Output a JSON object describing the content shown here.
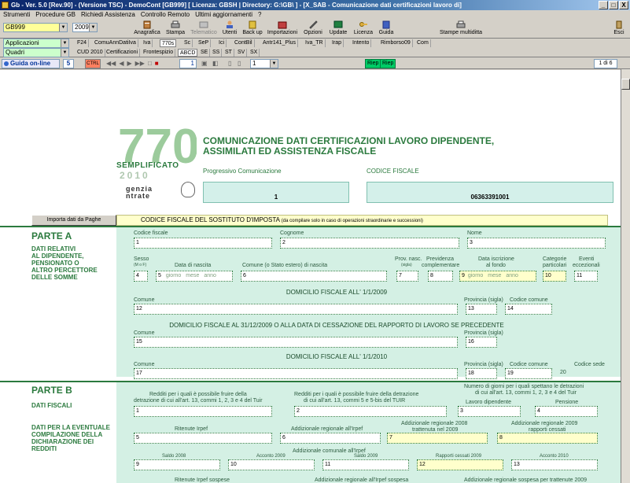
{
  "window": {
    "title": "Gb - Ver. 5.0 [Rev.90] - (Versione TSC) - DemoCont [GB999]   [ Licenza: GBSH | Directory: G:\\GB\\ ] - [X_SAB - Comunicazione dati certificazioni lavoro di]",
    "btn_minimize": "_",
    "btn_restore": "□",
    "btn_close": "X"
  },
  "menu": [
    "Strumenti",
    "Procedure GB",
    "Richiedi Assistenza",
    "Controllo Remoto",
    "Ultimi aggiornamenti",
    "?"
  ],
  "toolbar": {
    "company": "GB999",
    "year": "2009",
    "buttons": [
      "Anagrafica",
      "Stampa",
      "Telematico",
      "Utenti",
      "Back up",
      "Importazioni",
      "Opzioni",
      "Update",
      "Licenza",
      "Guida",
      "Stampe multiditta",
      "Esci"
    ]
  },
  "row2": {
    "combo": "Applicazioni",
    "tabs": [
      "F24",
      "ComuAnnDatiIva",
      "Iva",
      "770s",
      "Sc",
      "SeP",
      "Ici",
      "ContBil",
      "Antr141_Plus",
      "Iva_TR",
      "Irap",
      "Intento",
      "Rimborso09",
      "Com"
    ]
  },
  "row3": {
    "combo": "Quadri",
    "tabs": [
      "CUD 2010",
      "Certificazioni",
      "Frontespizio",
      "ABCD",
      "SE",
      "SS",
      "ST",
      "SV",
      "SX"
    ]
  },
  "nav": {
    "guida": "Guida on-line",
    "five": "5",
    "ctrl": "CTRL",
    "page": "1",
    "page2": "1",
    "riep1": "Riep",
    "riep2": "Riep",
    "pagenum": "1 di 6"
  },
  "doc": {
    "logo_number": "770",
    "logo_semp": "SEMPLIFICATO",
    "logo_year": "2010",
    "agenzia_line1": "genzia",
    "agenzia_line2": "ntrate",
    "title_line1": "COMUNICAZIONE DATI CERTIFICAZIONI LAVORO DIPENDENTE,",
    "title_line2": "ASSIMILATI ED ASSISTENZA FISCALE",
    "prog_label": "Progressivo Comunicazione",
    "cf_label": "CODICE FISCALE",
    "prog_value": "1",
    "cf_value": "06363391001",
    "import_btn": "Importa dati da Paghe",
    "cf_sostituto": "CODICE FISCALE DEL SOSTITUTO D'IMPOSTA",
    "cf_sostituto_note": "(da compilare solo in caso di operazioni straordinarie e successioni)",
    "parteA": {
      "title": "PARTE A",
      "desc": [
        "DATI RELATIVI",
        "AL DIPENDENTE,",
        "PENSIONATO O",
        "ALTRO PERCETTORE",
        "DELLE SOMME"
      ],
      "labels": {
        "cf": "Codice fiscale",
        "cognome": "Cognome",
        "nome": "Nome",
        "sesso": "Sesso",
        "sesso_mf": "(M o F)",
        "nascita": "Data di nascita",
        "comune_nasc": "Comune (o Stato estero) di nascita",
        "prov": "Prov. nasc.",
        "prov_sigla": "(sigla)",
        "previdenza": "Previdenza",
        "previdenza2": "complementare",
        "iscr": "Data iscrizione",
        "iscr2": "al fondo",
        "categorie": "Categorie",
        "categorie2": "particolari",
        "eventi": "Eventi",
        "eventi2": "eccezionali",
        "giorno": "giorno",
        "mese": "mese",
        "anno": "anno",
        "dom_2009": "DOMICILIO FISCALE ALL' 1/1/2009",
        "comune": "Comune",
        "provincia": "Provincia (sigla)",
        "cod_comune": "Codice comune",
        "dom_cessazione": "DOMICILIO FISCALE AL 31/12/2009 O ALLA DATA DI CESSAZIONE DEL RAPPORTO DI LAVORO SE PRECEDENTE",
        "dom_2010": "DOMICILIO FISCALE ALL' 1/1/2010",
        "cod_sede": "Codice sede"
      },
      "nums": {
        "f1": "1",
        "f2": "2",
        "f3": "3",
        "f4": "4",
        "f5": "5",
        "f6": "6",
        "f7": "7",
        "f8": "8",
        "f9": "9",
        "f10": "10",
        "f11": "11",
        "f12": "12",
        "f13": "13",
        "f14": "14",
        "f15": "15",
        "f16": "16",
        "f17": "17",
        "f18": "18",
        "f19": "19",
        "f20": "20"
      }
    },
    "parteB": {
      "title": "PARTE B",
      "desc1": "DATI FISCALI",
      "desc2": [
        "DATI PER LA EVENTUALE",
        "COMPILAZIONE DELLA",
        "DICHIARAZIONE DEI",
        "REDDITI"
      ],
      "labels": {
        "redditi1": "Redditi per i quali è possibile fruire della",
        "redditi1b": "detrazione di cui all'art. 13, commi 1, 2, 3 e 4 del Tuir",
        "redditi2": "Redditi per i quali è possibile fruire della detrazione",
        "redditi2b": "di cui all'art. 13, commi 5 e 5-bis del TUIR",
        "giorni": "Numero di giorni per i quali spettano le detrazioni",
        "giorni2": "di cui all'art. 13, commi 1, 2, 3 e 4 del Tuir",
        "lavoro": "Lavoro dipendente",
        "pensione": "Pensione",
        "ritenute": "Ritenute Irpef",
        "add_reg": "Addizionale regionale all'Irpef",
        "add_reg_2008": "Addizionale regionale 2008",
        "add_reg_2008b": "trattenuta nel 2009",
        "add_reg_2009": "Addizionale regionale 2009",
        "add_reg_2009b": "rapporti cessati",
        "add_com": "Addizionale comunale all'Irpef",
        "saldo2008": "Saldo 2008",
        "acconto2009": "Acconto 2009",
        "saldo2009": "Saldo 2009",
        "rapporti2009": "Rapporti cessati 2009",
        "acconto2010": "Acconto 2010",
        "rit_sospese": "Ritenute Irpef sospese",
        "add_reg_sospesa": "Addizionale regionale all'Irpef sospesa",
        "add_reg_sospesa2": "Addizionale regionale sospesa per trattenute 2009"
      },
      "nums": {
        "b1": "1",
        "b2": "2",
        "b3": "3",
        "b4": "4",
        "b5": "5",
        "b6": "6",
        "b7": "7",
        "b8": "8",
        "b9": "9",
        "b10": "10",
        "b11": "11",
        "b12": "12",
        "b13": "13"
      }
    }
  }
}
